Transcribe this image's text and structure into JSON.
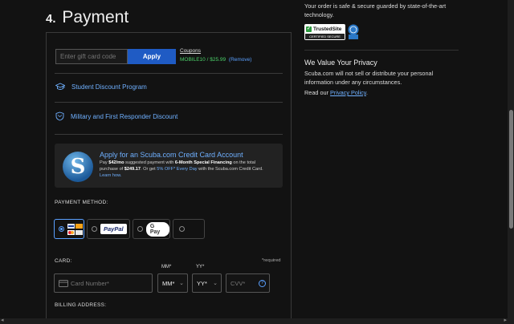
{
  "step": {
    "number": "4.",
    "title": "Payment"
  },
  "gift": {
    "placeholder": "Enter gift card code",
    "apply_label": "Apply",
    "coupons_label": "Coupons",
    "coupon_code": "MOBILE10 / $25.99",
    "remove_label": "(Remove)"
  },
  "discounts": {
    "student": "Student Discount Program",
    "military": "Military and First Responder Discount"
  },
  "promo": {
    "logo_letter": "S",
    "title": "Apply for an Scuba.com Credit Card Account",
    "line1_pre": "Pay ",
    "line1_amount": "$42/mo",
    "line1_mid": " suggested payment with ",
    "line1_fin": "6-Month Special Financing",
    "line1_post": " on the total",
    "line2_pre": "purchase of ",
    "line2_total": "$249.17",
    "line2_mid": ". Or get ",
    "line2_off": "5% OFF* Every Day",
    "line2_post": " with the Scuba.com Credit Card.",
    "learn_more": "Learn how."
  },
  "payment_method": {
    "label": "PAYMENT METHOD:",
    "paypal": "PayPal",
    "gpay": "G Pay"
  },
  "card": {
    "label": "CARD:",
    "required": "*required",
    "number_placeholder": "Card Number*",
    "mm_label": "MM*",
    "mm_value": "MM*",
    "yy_label": "YY*",
    "yy_value": "YY*",
    "cvv_placeholder": "CVV*"
  },
  "billing": {
    "label": "BILLING ADDRESS:"
  },
  "security": {
    "text": "Your order is safe & secure guarded by state-of-the-art technology.",
    "badge_main": "TrustedSite",
    "badge_sub": "CERTIFIED SECURE"
  },
  "privacy": {
    "heading": "We Value Your Privacy",
    "text": "Scuba.com will not sell or distribute your personal information under any circumstances.",
    "read_pre": "Read our ",
    "link": "Privacy Policy",
    "read_post": "."
  },
  "colors": {
    "accent": "#1f5bc4",
    "link": "#6fb0ff",
    "success": "#4cd36a",
    "background": "#121212"
  }
}
